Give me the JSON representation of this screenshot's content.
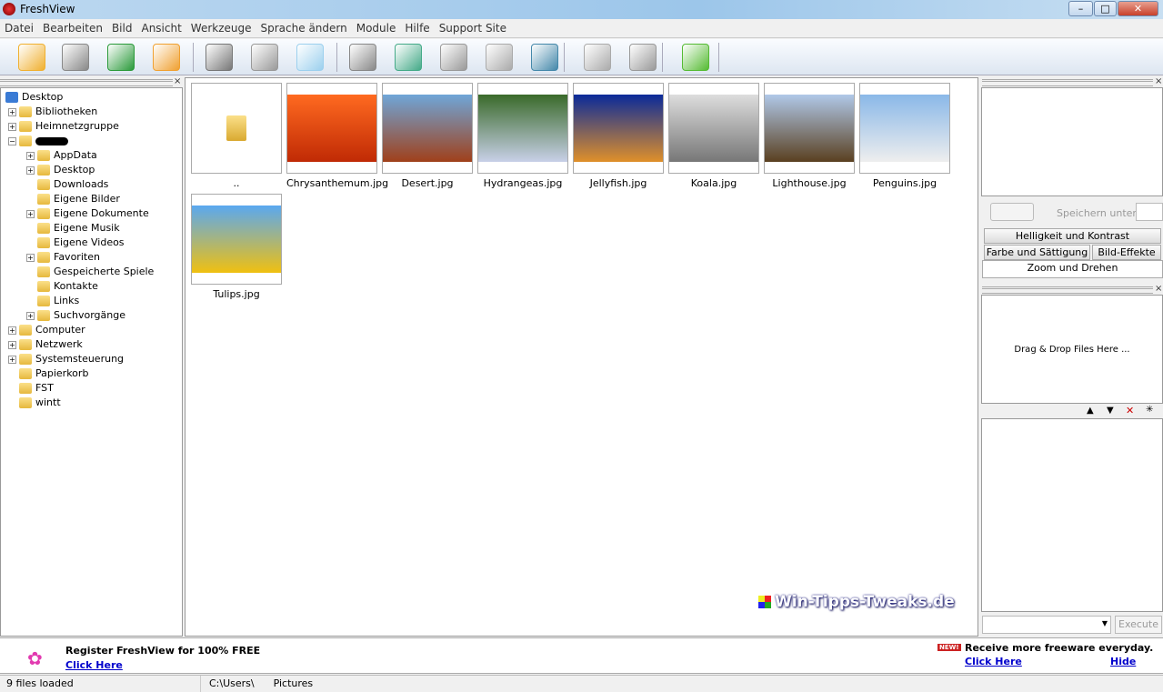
{
  "window": {
    "title": "FreshView",
    "minimize": "–",
    "maximize": "□",
    "close": "✕"
  },
  "menu": [
    "Datei",
    "Bearbeiten",
    "Bild",
    "Ansicht",
    "Werkzeuge",
    "Sprache ändern",
    "Module",
    "Hilfe",
    "Support Site"
  ],
  "toolbar": [
    {
      "name": "open-folder-icon",
      "color": "#f0b030"
    },
    {
      "name": "print-icon",
      "color": "#888"
    },
    {
      "name": "refresh-icon",
      "color": "#2a9a3a"
    },
    {
      "name": "home-folder-icon",
      "color": "#f0a030"
    },
    {
      "name": "cut-icon",
      "color": "#777"
    },
    {
      "name": "paste-icon",
      "color": "#999"
    },
    {
      "name": "copy-icon",
      "color": "#9cd0ee"
    },
    {
      "name": "clipboard-image-icon",
      "color": "#888"
    },
    {
      "name": "slideshow-icon",
      "color": "#4a8"
    },
    {
      "name": "batch-images-icon",
      "color": "#999"
    },
    {
      "name": "convert-icon",
      "color": "#aaa"
    },
    {
      "name": "scanner-icon",
      "color": "#48a"
    },
    {
      "name": "check-icon",
      "color": "#aaa"
    },
    {
      "name": "email-icon",
      "color": "#999"
    },
    {
      "name": "plugins-icon",
      "color": "#5b3"
    }
  ],
  "tree": [
    {
      "label": "Desktop",
      "level": 0,
      "exp": ""
    },
    {
      "label": "Bibliotheken",
      "level": 1,
      "exp": "+"
    },
    {
      "label": "Heimnetzgruppe",
      "level": 1,
      "exp": "+"
    },
    {
      "label": "",
      "level": 1,
      "exp": "−"
    },
    {
      "label": "AppData",
      "level": 2,
      "exp": "+"
    },
    {
      "label": "Desktop",
      "level": 2,
      "exp": "+"
    },
    {
      "label": "Downloads",
      "level": 2,
      "exp": ""
    },
    {
      "label": "Eigene Bilder",
      "level": 2,
      "exp": ""
    },
    {
      "label": "Eigene Dokumente",
      "level": 2,
      "exp": "+"
    },
    {
      "label": "Eigene Musik",
      "level": 2,
      "exp": ""
    },
    {
      "label": "Eigene Videos",
      "level": 2,
      "exp": ""
    },
    {
      "label": "Favoriten",
      "level": 2,
      "exp": "+"
    },
    {
      "label": "Gespeicherte Spiele",
      "level": 2,
      "exp": ""
    },
    {
      "label": "Kontakte",
      "level": 2,
      "exp": ""
    },
    {
      "label": "Links",
      "level": 2,
      "exp": ""
    },
    {
      "label": "Suchvorgänge",
      "level": 2,
      "exp": "+"
    },
    {
      "label": "Computer",
      "level": 1,
      "exp": "+"
    },
    {
      "label": "Netzwerk",
      "level": 1,
      "exp": "+"
    },
    {
      "label": "Systemsteuerung",
      "level": 1,
      "exp": "+"
    },
    {
      "label": "Papierkorb",
      "level": 1,
      "exp": ""
    },
    {
      "label": "FST",
      "level": 1,
      "exp": ""
    },
    {
      "label": "wintt",
      "level": 1,
      "exp": ""
    }
  ],
  "files": [
    {
      "label": "..",
      "colors": [
        "#fff",
        "#fff"
      ]
    },
    {
      "label": "Chrysanthemum.jpg",
      "colors": [
        "#ff6a20",
        "#c02a05"
      ]
    },
    {
      "label": "Desert.jpg",
      "colors": [
        "#6fa6d8",
        "#a0401a"
      ]
    },
    {
      "label": "Hydrangeas.jpg",
      "colors": [
        "#3a6a2a",
        "#c8d0e8"
      ]
    },
    {
      "label": "Jellyfish.jpg",
      "colors": [
        "#0a2a9a",
        "#e0902a"
      ]
    },
    {
      "label": "Koala.jpg",
      "colors": [
        "#ddd",
        "#777"
      ]
    },
    {
      "label": "Lighthouse.jpg",
      "colors": [
        "#b0c8e8",
        "#5a4020"
      ]
    },
    {
      "label": "Penguins.jpg",
      "colors": [
        "#8ab8e8",
        "#eee"
      ]
    },
    {
      "label": "Tulips.jpg",
      "colors": [
        "#5aa8f0",
        "#f0c010"
      ]
    }
  ],
  "watermark": "Win-Tipps-Tweaks.de",
  "right": {
    "save_as": "Speichern unter :",
    "tabs": [
      "Helligkeit und Kontrast",
      "Farbe und Sättigung",
      "Bild-Effekte",
      "Zoom und Drehen"
    ],
    "drop": "Drag & Drop Files Here ...",
    "execute": "Execute"
  },
  "banner": {
    "register": "Register FreshView for 100% FREE",
    "click": "Click Here",
    "new": "NEW!",
    "freeware": "Receive more freeware everyday.",
    "click2": "Click Here",
    "hide": "Hide"
  },
  "status": {
    "count": "9 files loaded",
    "path": "C:\\Users\\      Pictures"
  }
}
